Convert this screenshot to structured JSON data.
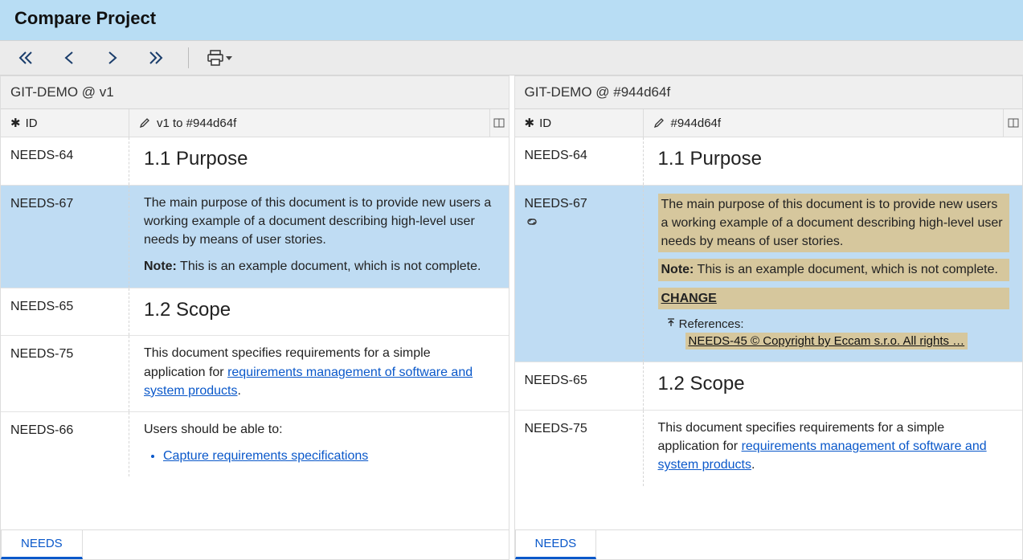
{
  "title": "Compare Project",
  "toolbar": {
    "first": "first",
    "prev": "prev",
    "next": "next",
    "last": "last",
    "print": "print"
  },
  "left": {
    "header": "GIT-DEMO @ v1",
    "idLabel": "ID",
    "descLabel": "v1 to #944d64f",
    "rows": [
      {
        "id": "NEEDS-64",
        "kind": "heading",
        "text": "1.1 Purpose"
      },
      {
        "id": "NEEDS-67",
        "kind": "selected",
        "body": "The main purpose of this document is to provide new users a working example of a document describing high-level user needs by means of user stories.",
        "noteLabel": "Note:",
        "note": "This is an example document, which is not complete."
      },
      {
        "id": "NEEDS-65",
        "kind": "heading",
        "text": "1.2 Scope"
      },
      {
        "id": "NEEDS-75",
        "kind": "para",
        "before": "This document specifies requirements for a simple application for ",
        "link": "requirements management of software and system products",
        "after": "."
      },
      {
        "id": "NEEDS-66",
        "kind": "list",
        "lead": "Users should be able to:",
        "item1": "Capture requirements specifications"
      }
    ],
    "tab": "NEEDS"
  },
  "right": {
    "header": "GIT-DEMO @ #944d64f",
    "idLabel": "ID",
    "descLabel": "#944d64f",
    "rows": [
      {
        "id": "NEEDS-64",
        "kind": "heading",
        "text": "1.1 Purpose"
      },
      {
        "id": "NEEDS-67",
        "kind": "selected-diff",
        "body": "The main purpose of this document is to provide new users a working example of a document describing high-level user needs by means of user stories.",
        "noteLabel": "Note:",
        "note": "This is an example document, which is not complete.",
        "change": "CHANGE",
        "refsLabel": "References:",
        "refLink": "NEEDS-45 © Copyright by Eccam s.r.o. All rights …"
      },
      {
        "id": "NEEDS-65",
        "kind": "heading",
        "text": "1.2 Scope"
      },
      {
        "id": "NEEDS-75",
        "kind": "para",
        "before": "This document specifies requirements for a simple application for ",
        "link": "requirements management of software and system products",
        "after": "."
      }
    ],
    "tab": "NEEDS"
  }
}
